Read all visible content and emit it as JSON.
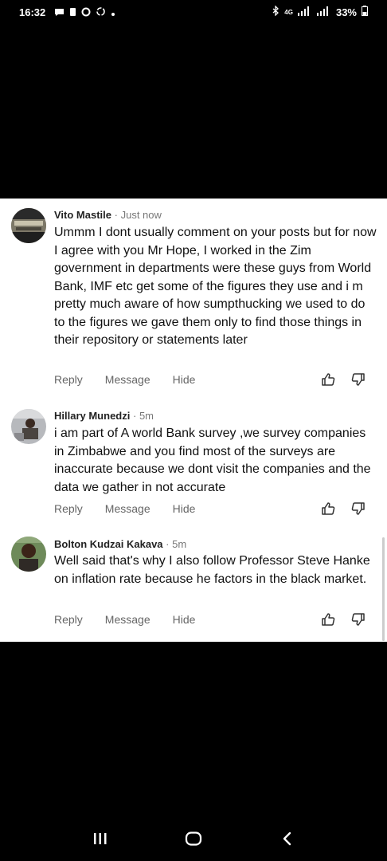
{
  "status_bar": {
    "time": "16:32",
    "network": "4G",
    "battery": "33%"
  },
  "comments": [
    {
      "author": "Vito Mastile",
      "time": "Just now",
      "text": "Ummm I dont usually comment on your posts but for now I agree with you Mr Hope, I worked in the Zim government in departments were these guys from World Bank, IMF etc get some of the figures they use and i m pretty much aware of how sumpthucking we used to do to the figures we gave them only to find those things in their repository or statements later",
      "reply": "Reply",
      "message": "Message",
      "hide": "Hide"
    },
    {
      "author": "Hillary Munedzi",
      "time": "5m",
      "text": "i am part of A world Bank survey ,we survey companies in Zimbabwe and you find most of the surveys are inaccurate because we dont visit the companies and the data we gather in not accurate",
      "reply": "Reply",
      "message": "Message",
      "hide": "Hide"
    },
    {
      "author": "Bolton Kudzai Kakava",
      "time": "5m",
      "text": "Well said that's why I also follow Professor Steve Hanke on inflation rate because he factors in the black market.",
      "reply": "Reply",
      "message": "Message",
      "hide": "Hide"
    }
  ],
  "colors": {
    "panel_bg": "#ffffff",
    "screen_bg": "#000000",
    "action_text": "#666666"
  }
}
